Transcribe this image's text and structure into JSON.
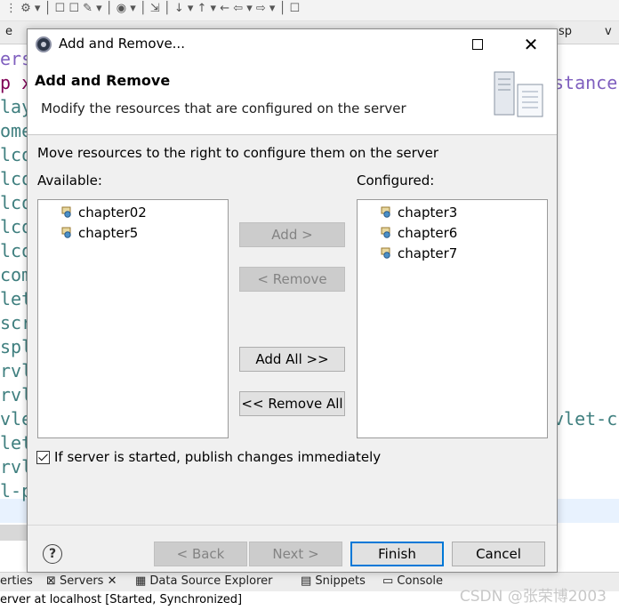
{
  "ide": {
    "tabs": [
      "e",
      "sp",
      "v"
    ],
    "code_fragments": [
      "ers",
      "p x",
      "lay",
      "ome",
      "lco",
      "lco",
      "lco",
      "lco",
      "lco",
      "com",
      "let",
      "scr",
      "spl",
      "rvl",
      "rvl",
      "vle",
      "let",
      "rvl",
      "l-p"
    ],
    "code_right_1": "stance",
    "code_right_2": "vlet-c",
    "view_tabs": [
      "erties",
      "Servers",
      "Data Source Explorer",
      "Snippets",
      "Console"
    ],
    "status_line": "erver at localhost  [Started, Synchronized]",
    "watermark": "CSDN @张荣博2003"
  },
  "dialog": {
    "title": "Add and Remove...",
    "header_title": "Add and Remove",
    "header_description": "Modify the resources that are configured on the server",
    "instructions": "Move resources to the right to configure them on the server",
    "available_label": "Available:",
    "configured_label": "Configured:",
    "available_items": [
      "chapter02",
      "chapter5"
    ],
    "configured_items": [
      "chapter3",
      "chapter6",
      "chapter7"
    ],
    "buttons": {
      "add": "Add >",
      "remove": "< Remove",
      "add_all": "Add All >>",
      "remove_all": "<< Remove All",
      "back": "< Back",
      "next": "Next >",
      "finish": "Finish",
      "cancel": "Cancel",
      "help": "?"
    },
    "checkbox_label": "If server is started, publish changes immediately",
    "checkbox_checked": true
  },
  "colors": {
    "accent": "#0078d7",
    "disabled_text": "#838383"
  }
}
